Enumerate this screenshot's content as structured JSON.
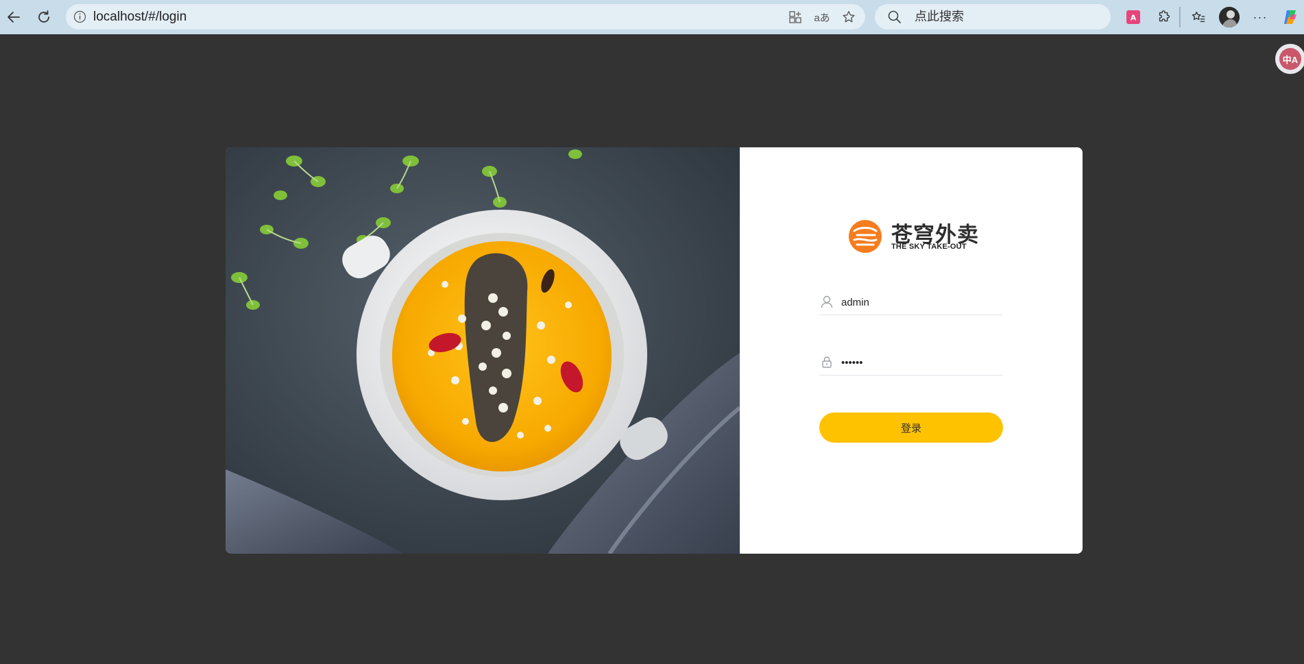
{
  "browser": {
    "url": "localhost/#/login",
    "search_placeholder": "点此搜索",
    "translate_bubble_label": "中A"
  },
  "login": {
    "logo_cn": "苍穹外卖",
    "logo_en": "THE SKY TAKE-OUT",
    "username_value": "admin",
    "password_value": "••••••",
    "submit_label": "登录"
  },
  "colors": {
    "page_bg": "#333333",
    "accent": "#ffc200",
    "logo_orange": "#f57c1f"
  }
}
